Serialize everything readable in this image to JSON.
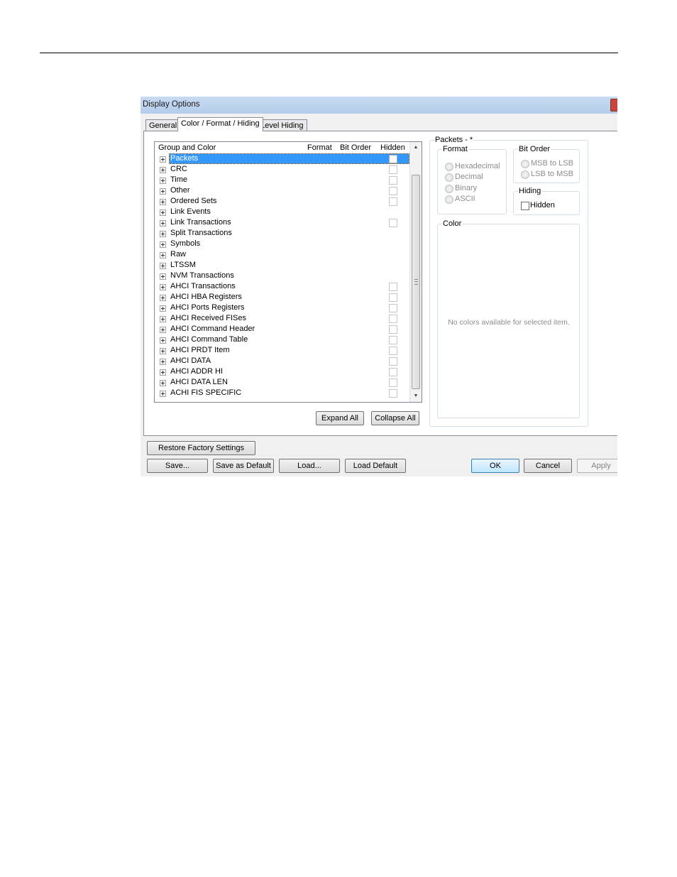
{
  "window": {
    "title": "Display Options"
  },
  "tabs": [
    {
      "label": "General"
    },
    {
      "label": "Color / Format / Hiding"
    },
    {
      "label": "Level Hiding"
    }
  ],
  "tree": {
    "columns": {
      "group": "Group and Color",
      "format": "Format",
      "bit_order": "Bit Order",
      "hidden": "Hidden"
    },
    "rows": [
      {
        "label": "Packets",
        "selected": true,
        "checkbox": true
      },
      {
        "label": "CRC",
        "checkbox": true
      },
      {
        "label": "Time",
        "checkbox": true
      },
      {
        "label": "Other",
        "checkbox": true
      },
      {
        "label": "Ordered Sets",
        "checkbox": true
      },
      {
        "label": "Link Events",
        "checkbox": false
      },
      {
        "label": "Link Transactions",
        "checkbox": true
      },
      {
        "label": "Split Transactions",
        "checkbox": false
      },
      {
        "label": "Symbols",
        "checkbox": false
      },
      {
        "label": "Raw",
        "checkbox": false
      },
      {
        "label": "LTSSM",
        "checkbox": false
      },
      {
        "label": "NVM Transactions",
        "checkbox": false
      },
      {
        "label": "AHCI Transactions",
        "checkbox": true
      },
      {
        "label": "AHCI HBA Registers",
        "checkbox": true
      },
      {
        "label": "AHCI Ports Registers",
        "checkbox": true
      },
      {
        "label": "AHCI Received FISes",
        "checkbox": true
      },
      {
        "label": "AHCI Command Header",
        "checkbox": true
      },
      {
        "label": "AHCI Command Table",
        "checkbox": true
      },
      {
        "label": "AHCI PRDT Item",
        "checkbox": true
      },
      {
        "label": "AHCI DATA",
        "checkbox": true
      },
      {
        "label": "AHCI ADDR HI",
        "checkbox": true
      },
      {
        "label": "AHCI DATA LEN",
        "checkbox": true
      },
      {
        "label": "ACHI FIS SPECIFIC",
        "checkbox": true
      }
    ]
  },
  "tree_buttons": {
    "expand_all": "Expand All",
    "collapse_all": "Collapse All"
  },
  "details": {
    "title": "Packets - *",
    "format": {
      "title": "Format",
      "options": [
        "Hexadecimal",
        "Decimal",
        "Binary",
        "ASCII"
      ]
    },
    "bit_order": {
      "title": "Bit Order",
      "options": [
        "MSB to LSB",
        "LSB to MSB"
      ]
    },
    "hiding": {
      "title": "Hiding",
      "checkbox_label": "Hidden"
    },
    "color": {
      "title": "Color",
      "empty_message": "No colors available for selected item."
    }
  },
  "footer": {
    "restore": "Restore Factory Settings",
    "save": "Save...",
    "save_default": "Save as Default",
    "load": "Load...",
    "load_default": "Load Default",
    "ok": "OK",
    "cancel": "Cancel",
    "apply": "Apply"
  },
  "colors": {
    "selection": "#3399ff",
    "titlebar": "#c7dbf2",
    "disabled_text": "#8c8c8c"
  }
}
